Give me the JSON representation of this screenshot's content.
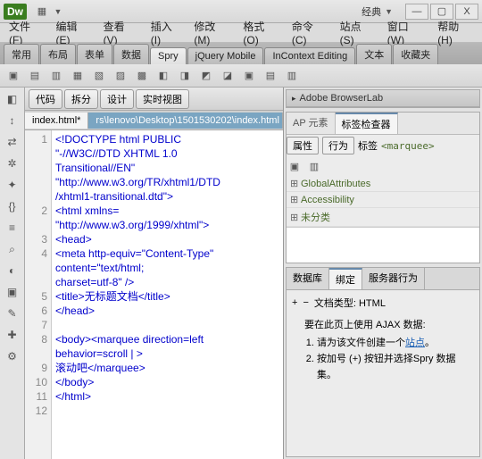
{
  "app": {
    "logo": "Dw",
    "mode": "经典"
  },
  "winbtns": {
    "min": "—",
    "max": "▢",
    "close": "X"
  },
  "menu": [
    "文件(F)",
    "编辑(E)",
    "查看(V)",
    "插入(I)",
    "修改(M)",
    "格式(O)",
    "命令(C)",
    "站点(S)",
    "窗口(W)",
    "帮助(H)"
  ],
  "tabs": [
    "常用",
    "布局",
    "表单",
    "数据",
    "Spry",
    "jQuery Mobile",
    "InContext Editing",
    "文本",
    "收藏夹"
  ],
  "activeTab": 4,
  "viewbar": [
    "代码",
    "拆分",
    "设计",
    "实时视图"
  ],
  "filetabs": {
    "active": "index.html*",
    "inactive": "rs\\lenovo\\Desktop\\1501530202\\index.html"
  },
  "gutter": [
    "1",
    "",
    "",
    "",
    "",
    "2",
    "",
    "3",
    "4",
    "",
    "",
    "5",
    "6",
    "7",
    "8",
    "",
    "9",
    "10",
    "11",
    "12"
  ],
  "code": "<!DOCTYPE html PUBLIC\n\"-//W3C//DTD XHTML 1.0\nTransitional//EN\"\n\"http://www.w3.org/TR/xhtml1/DTD\n/xhtml1-transitional.dtd\">\n<html xmlns=\n\"http://www.w3.org/1999/xhtml\">\n<head>\n<meta http-equiv=\"Content-Type\"\ncontent=\"text/html;\ncharset=utf-8\" />\n<title>无标题文档</title>\n</head>\n\n<body><marquee direction=left\nbehavior=scroll | >\n滚动吧</marquee>\n</body>\n</html>\n",
  "right": {
    "panel1": "Adobe BrowserLab",
    "subtabs": [
      "AP 元素",
      "标签检查器"
    ],
    "activeSub": 1,
    "propTabs": [
      "属性",
      "行为",
      "标签"
    ],
    "propTag": "<marquee>",
    "groups": [
      "GlobalAttributes",
      "Accessibility",
      "未分类"
    ],
    "lowerTabs": [
      "数据库",
      "绑定",
      "服务器行为"
    ],
    "activeLower": 1,
    "docType": "文档类型: HTML",
    "ajaxTitle": "要在此页上使用 AJAX 数据:",
    "steps": [
      "请为该文件创建一个",
      "按加号 (+) 按钮并选择Spry 数据集。"
    ],
    "siteLink": "站点"
  }
}
